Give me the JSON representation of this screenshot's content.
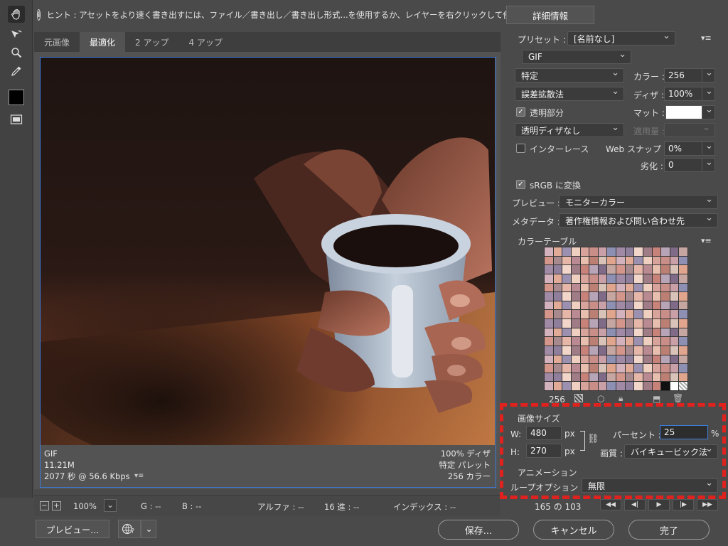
{
  "hint": {
    "text": "ヒント : アセットをより速く書き出すには、ファイル／書き出し／書き出し形式...を使用するか、レイヤーを右クリックして使用。",
    "details_button": "詳細情報"
  },
  "tabs": [
    {
      "label": "元画像",
      "selected": false
    },
    {
      "label": "最適化",
      "selected": true
    },
    {
      "label": "2 アップ",
      "selected": false
    },
    {
      "label": "4 アップ",
      "selected": false
    }
  ],
  "image_info": {
    "format": "GIF",
    "size": "11.21M",
    "time": "2077 秒 @ 56.6 Kbps",
    "dither": "100% ディザ",
    "palette": "特定 パレット",
    "colors": "256 カラー"
  },
  "status": {
    "zoom": "100%",
    "g": "G : --",
    "b": "B : --",
    "alpha": "アルファ : --",
    "hex": "16 進 : --",
    "index": "インデックス : --"
  },
  "panel": {
    "preset_label": "プリセット :",
    "preset_value": "[名前なし]",
    "format_value": "GIF",
    "reduction_value": "特定",
    "colors_label": "カラー :",
    "colors_value": "256",
    "dither_method": "誤差拡散法",
    "dither_label": "ディザ :",
    "dither_value": "100%",
    "transparency_label": "透明部分",
    "matte_label": "マット :",
    "trans_dither": "透明ディザなし",
    "amount_label": "適用量 :",
    "interlace_label": "インターレース",
    "websnap_label": "Web スナップ :",
    "websnap_value": "0%",
    "lossy_label": "劣化 :",
    "lossy_value": "0",
    "srgb_label": "sRGB に変換",
    "preview_label": "プレビュー :",
    "preview_value": "モニターカラー",
    "metadata_label": "メタデータ :",
    "metadata_value": "著作権情報および問い合わせ先",
    "color_table_label": "カラーテーブル",
    "color_count": "256",
    "image_size_label": "画像サイズ",
    "w_label": "W:",
    "w_value": "480",
    "h_label": "H:",
    "h_value": "270",
    "px": "px",
    "percent_label": "パーセント :",
    "percent_value": "25",
    "percent_sign": "%",
    "quality_label": "画質 :",
    "quality_value": "バイキュービック法",
    "animation_label": "アニメーション",
    "loop_label": "ループオプション :",
    "loop_value": "無限",
    "frame_counter": "165 の 103"
  },
  "buttons": {
    "preview": "プレビュー...",
    "save": "保存...",
    "cancel": "キャンセル",
    "done": "完了"
  },
  "colors": {
    "highlight": "#e0221f",
    "selection_border": "#3d7bd9"
  }
}
